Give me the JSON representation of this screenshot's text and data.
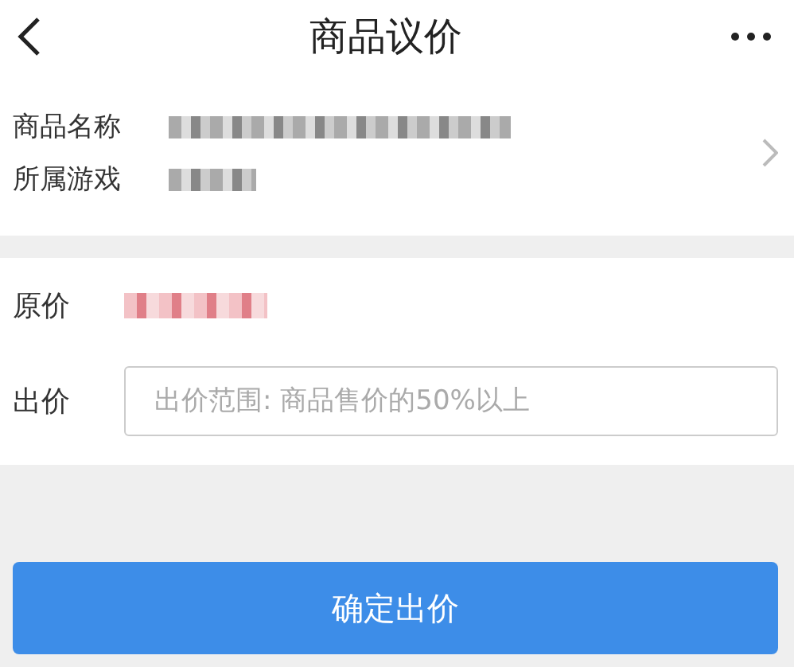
{
  "header": {
    "title": "商品议价"
  },
  "product": {
    "fields": [
      {
        "label": "商品名称"
      },
      {
        "label": "所属游戏"
      }
    ]
  },
  "price": {
    "label": "原价"
  },
  "offer": {
    "label": "出价",
    "placeholder": "出价范围: 商品售价的50%以上"
  },
  "submit_button": {
    "label": "确定出价"
  }
}
